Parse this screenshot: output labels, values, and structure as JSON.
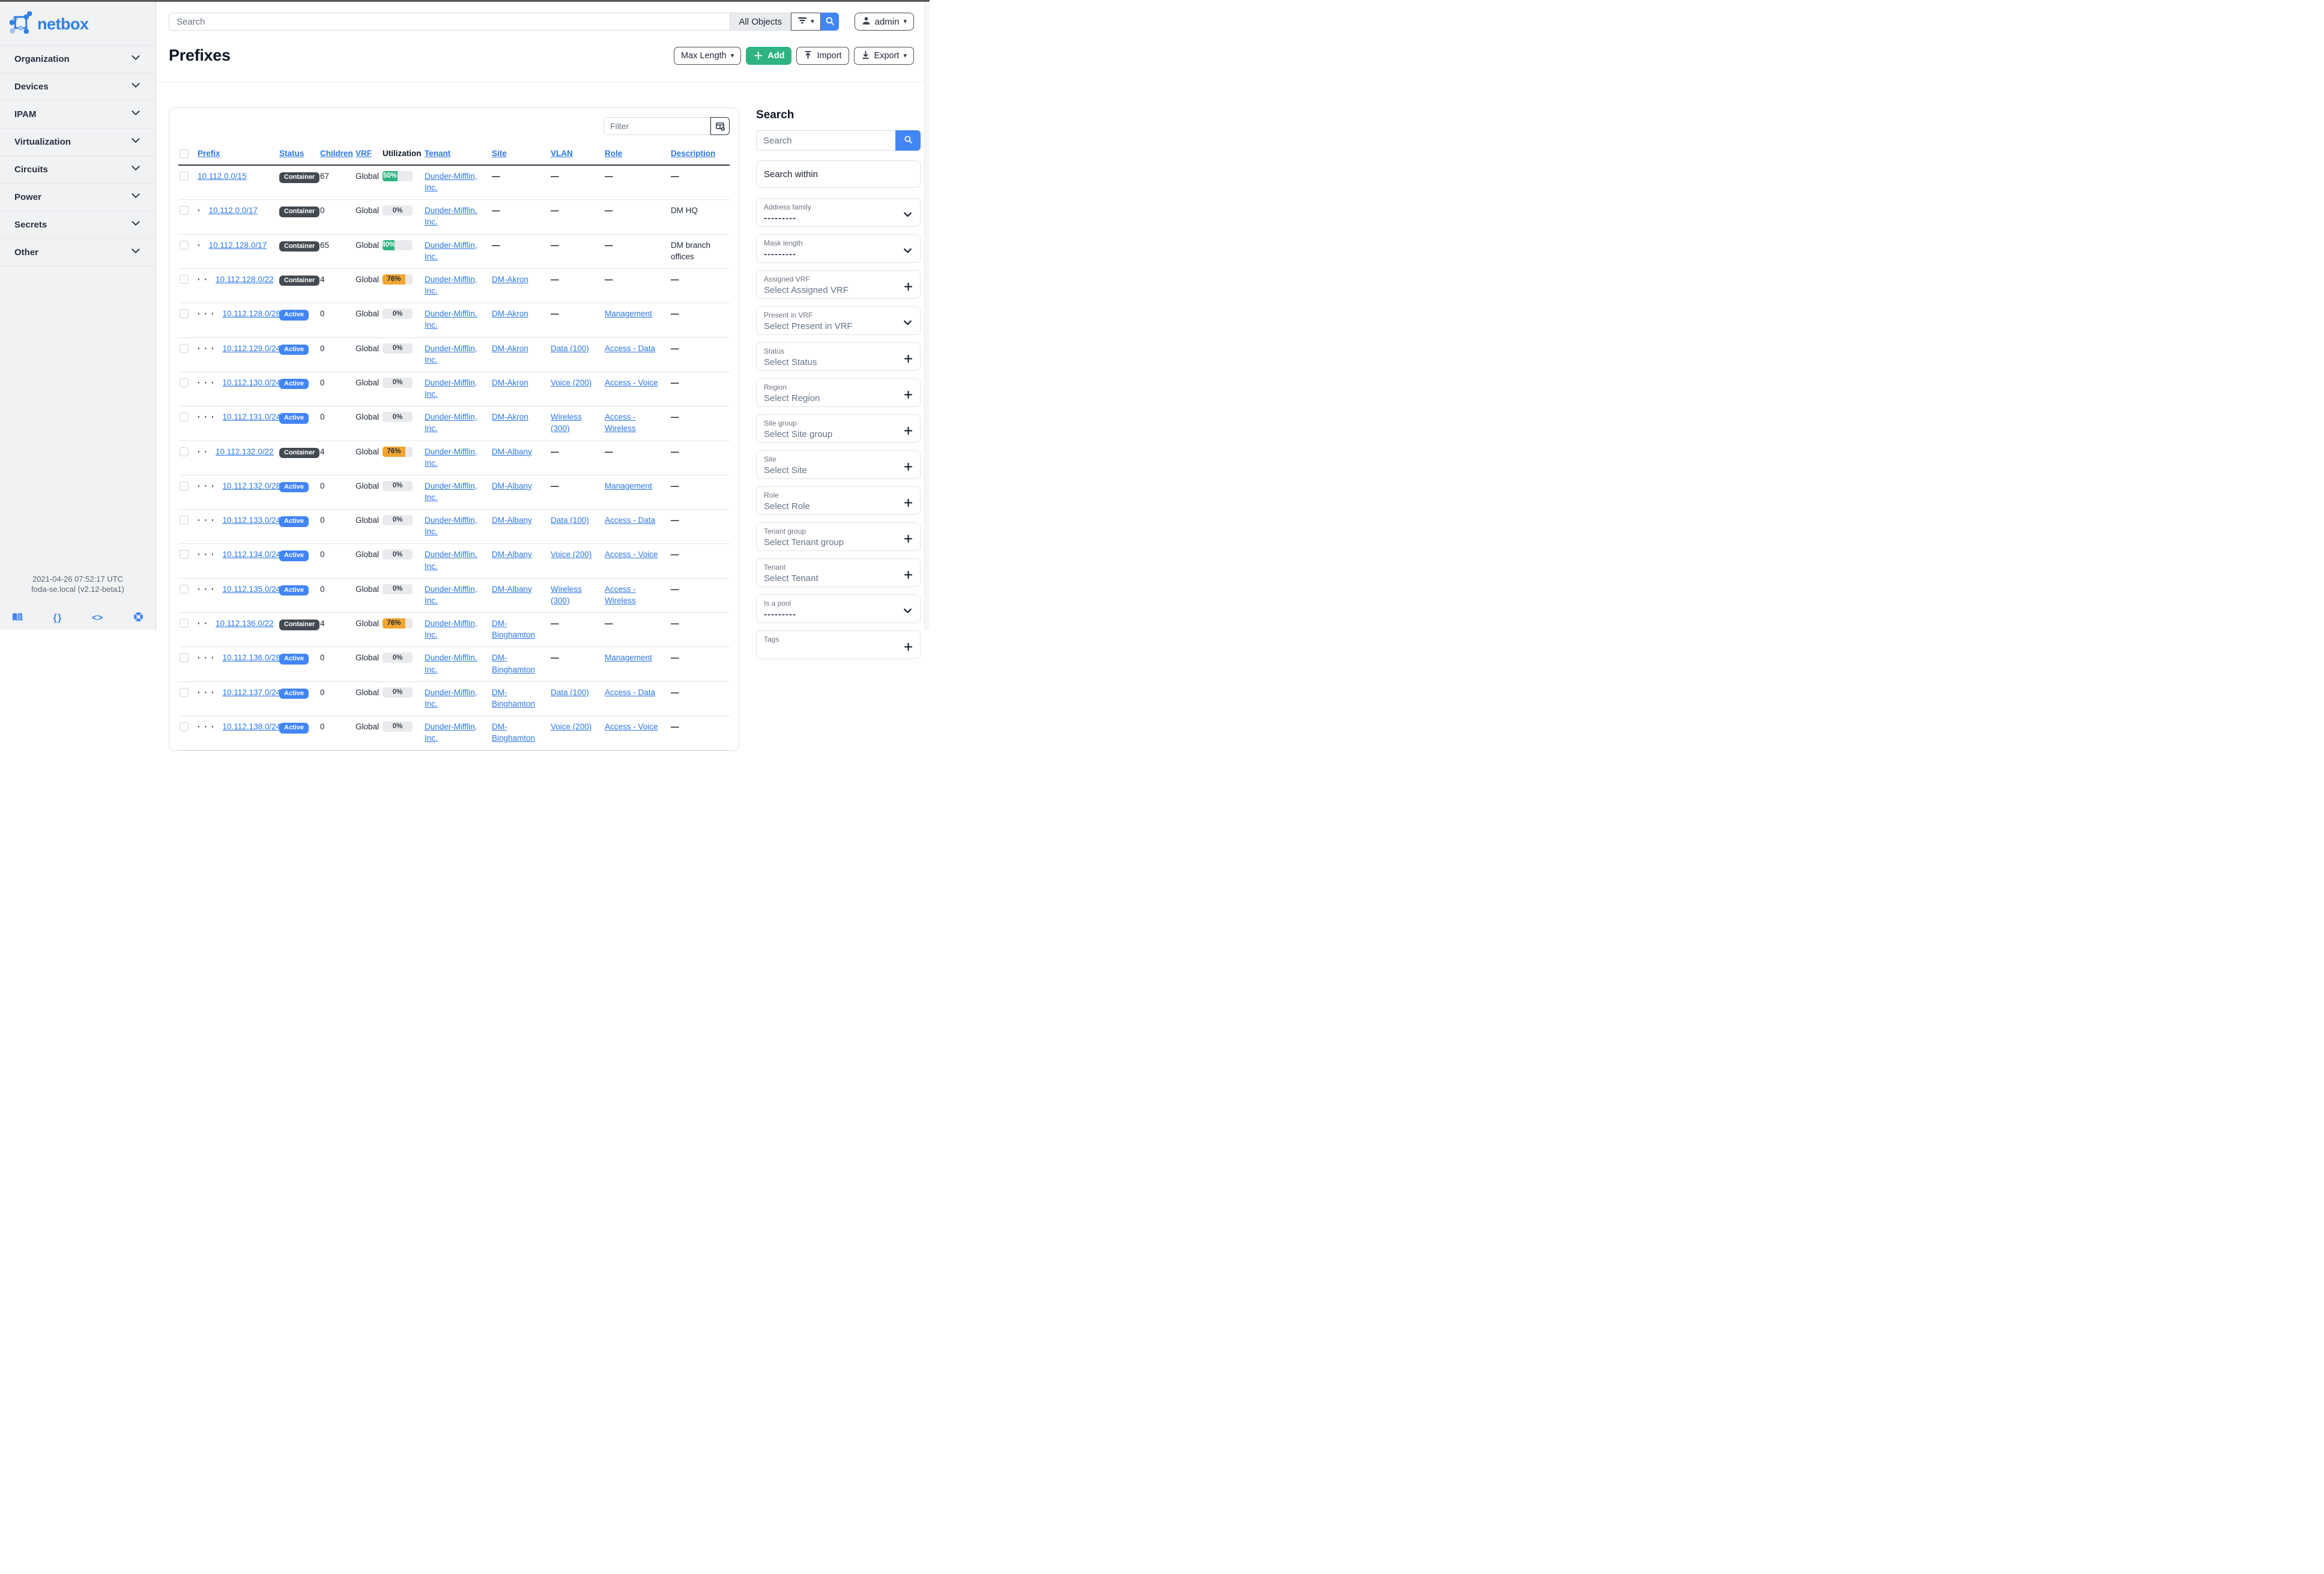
{
  "topbar": {
    "search_placeholder": "Search",
    "scope_label": "All Objects",
    "user_label": "admin"
  },
  "sidebar": {
    "brand": "netbox",
    "items": [
      {
        "label": "Organization"
      },
      {
        "label": "Devices"
      },
      {
        "label": "IPAM"
      },
      {
        "label": "Virtualization"
      },
      {
        "label": "Circuits"
      },
      {
        "label": "Power"
      },
      {
        "label": "Secrets"
      },
      {
        "label": "Other"
      }
    ],
    "footer": {
      "timestamp": "2021-04-26 07:52:17 UTC",
      "host": "foda-se.local (v2.12-beta1)",
      "icons": [
        "docs-book",
        "rest-api-braces",
        "code",
        "help-lifebuoy"
      ]
    }
  },
  "page": {
    "title": "Prefixes",
    "actions": {
      "max_length": "Max Length",
      "add": "Add",
      "import": "Import",
      "export": "Export"
    }
  },
  "table": {
    "filter_placeholder": "Filter",
    "columns": [
      {
        "label": "Prefix",
        "sortable": true
      },
      {
        "label": "Status",
        "sortable": true
      },
      {
        "label": "Children",
        "sortable": true
      },
      {
        "label": "VRF",
        "sortable": true
      },
      {
        "label": "Utilization",
        "sortable": false
      },
      {
        "label": "Tenant",
        "sortable": true
      },
      {
        "label": "Site",
        "sortable": true
      },
      {
        "label": "VLAN",
        "sortable": true
      },
      {
        "label": "Role",
        "sortable": true
      },
      {
        "label": "Description",
        "sortable": true
      }
    ],
    "rows": [
      {
        "depth": 0,
        "prefix": "10.112.0.0/15",
        "status": "Container",
        "children": "67",
        "vrf": "Global",
        "utilization": 50,
        "tenant": "Dunder-Mifflin, Inc.",
        "site": "—",
        "vlan": "—",
        "role": "—",
        "description": "—"
      },
      {
        "depth": 1,
        "prefix": "10.112.0.0/17",
        "status": "Container",
        "children": "0",
        "vrf": "Global",
        "utilization": 0,
        "tenant": "Dunder-Mifflin, Inc.",
        "site": "—",
        "vlan": "—",
        "role": "—",
        "description": "DM HQ"
      },
      {
        "depth": 1,
        "prefix": "10.112.128.0/17",
        "status": "Container",
        "children": "65",
        "vrf": "Global",
        "utilization": 40,
        "tenant": "Dunder-Mifflin, Inc.",
        "site": "—",
        "vlan": "—",
        "role": "—",
        "description": "DM branch offices"
      },
      {
        "depth": 2,
        "prefix": "10.112.128.0/22",
        "status": "Container",
        "children": "4",
        "vrf": "Global",
        "utilization": 76,
        "tenant": "Dunder-Mifflin, Inc.",
        "site": "DM-Akron",
        "vlan": "—",
        "role": "—",
        "description": "—"
      },
      {
        "depth": 3,
        "prefix": "10.112.128.0/28",
        "status": "Active",
        "children": "0",
        "vrf": "Global",
        "utilization": 0,
        "tenant": "Dunder-Mifflin, Inc.",
        "site": "DM-Akron",
        "vlan": "—",
        "role": "Management",
        "description": "—"
      },
      {
        "depth": 3,
        "prefix": "10.112.129.0/24",
        "status": "Active",
        "children": "0",
        "vrf": "Global",
        "utilization": 0,
        "tenant": "Dunder-Mifflin, Inc.",
        "site": "DM-Akron",
        "vlan": "Data (100)",
        "role": "Access - Data",
        "description": "—"
      },
      {
        "depth": 3,
        "prefix": "10.112.130.0/24",
        "status": "Active",
        "children": "0",
        "vrf": "Global",
        "utilization": 0,
        "tenant": "Dunder-Mifflin, Inc.",
        "site": "DM-Akron",
        "vlan": "Voice (200)",
        "role": "Access - Voice",
        "description": "—"
      },
      {
        "depth": 3,
        "prefix": "10.112.131.0/24",
        "status": "Active",
        "children": "0",
        "vrf": "Global",
        "utilization": 0,
        "tenant": "Dunder-Mifflin, Inc.",
        "site": "DM-Akron",
        "vlan": "Wireless (300)",
        "role": "Access - Wireless",
        "description": "—"
      },
      {
        "depth": 2,
        "prefix": "10.112.132.0/22",
        "status": "Container",
        "children": "4",
        "vrf": "Global",
        "utilization": 76,
        "tenant": "Dunder-Mifflin, Inc.",
        "site": "DM-Albany",
        "vlan": "—",
        "role": "—",
        "description": "—"
      },
      {
        "depth": 3,
        "prefix": "10.112.132.0/28",
        "status": "Active",
        "children": "0",
        "vrf": "Global",
        "utilization": 0,
        "tenant": "Dunder-Mifflin, Inc.",
        "site": "DM-Albany",
        "vlan": "—",
        "role": "Management",
        "description": "—"
      },
      {
        "depth": 3,
        "prefix": "10.112.133.0/24",
        "status": "Active",
        "children": "0",
        "vrf": "Global",
        "utilization": 0,
        "tenant": "Dunder-Mifflin, Inc.",
        "site": "DM-Albany",
        "vlan": "Data (100)",
        "role": "Access - Data",
        "description": "—"
      },
      {
        "depth": 3,
        "prefix": "10.112.134.0/24",
        "status": "Active",
        "children": "0",
        "vrf": "Global",
        "utilization": 0,
        "tenant": "Dunder-Mifflin, Inc.",
        "site": "DM-Albany",
        "vlan": "Voice (200)",
        "role": "Access - Voice",
        "description": "—"
      },
      {
        "depth": 3,
        "prefix": "10.112.135.0/24",
        "status": "Active",
        "children": "0",
        "vrf": "Global",
        "utilization": 0,
        "tenant": "Dunder-Mifflin, Inc.",
        "site": "DM-Albany",
        "vlan": "Wireless (300)",
        "role": "Access - Wireless",
        "description": "—"
      },
      {
        "depth": 2,
        "prefix": "10.112.136.0/22",
        "status": "Container",
        "children": "4",
        "vrf": "Global",
        "utilization": 76,
        "tenant": "Dunder-Mifflin, Inc.",
        "site": "DM-Binghamton",
        "vlan": "—",
        "role": "—",
        "description": "—"
      },
      {
        "depth": 3,
        "prefix": "10.112.136.0/28",
        "status": "Active",
        "children": "0",
        "vrf": "Global",
        "utilization": 0,
        "tenant": "Dunder-Mifflin, Inc.",
        "site": "DM-Binghamton",
        "vlan": "—",
        "role": "Management",
        "description": "—"
      },
      {
        "depth": 3,
        "prefix": "10.112.137.0/24",
        "status": "Active",
        "children": "0",
        "vrf": "Global",
        "utilization": 0,
        "tenant": "Dunder-Mifflin, Inc.",
        "site": "DM-Binghamton",
        "vlan": "Data (100)",
        "role": "Access - Data",
        "description": "—"
      },
      {
        "depth": 3,
        "prefix": "10.112.138.0/24",
        "status": "Active",
        "children": "0",
        "vrf": "Global",
        "utilization": 0,
        "tenant": "Dunder-Mifflin, Inc.",
        "site": "DM-Binghamton",
        "vlan": "Voice (200)",
        "role": "Access - Voice",
        "description": "—"
      }
    ]
  },
  "search_panel": {
    "title": "Search",
    "search_placeholder": "Search",
    "search_within_label": "Search within",
    "filters": [
      {
        "label": "Address family",
        "value": "---------",
        "control": "chevron"
      },
      {
        "label": "Mask length",
        "value": "---------",
        "control": "chevron"
      },
      {
        "label": "Assigned VRF",
        "value": "Select Assigned VRF",
        "control": "plus"
      },
      {
        "label": "Present in VRF",
        "value": "Select Present in VRF",
        "control": "chevron"
      },
      {
        "label": "Status",
        "value": "Select Status",
        "control": "plus"
      },
      {
        "label": "Region",
        "value": "Select Region",
        "control": "plus"
      },
      {
        "label": "Site group",
        "value": "Select Site group",
        "control": "plus"
      },
      {
        "label": "Site",
        "value": "Select Site",
        "control": "plus"
      },
      {
        "label": "Role",
        "value": "Select Role",
        "control": "plus"
      },
      {
        "label": "Tenant group",
        "value": "Select Tenant group",
        "control": "plus"
      },
      {
        "label": "Tenant",
        "value": "Select Tenant",
        "control": "plus"
      },
      {
        "label": "Is a pool",
        "value": "---------",
        "control": "chevron"
      },
      {
        "label": "Tags",
        "value": "",
        "control": "plus"
      }
    ]
  },
  "colors": {
    "accent_blue": "#4285f4",
    "link_blue": "#2b77e5",
    "badge_container": "#434a52",
    "badge_active": "#4285f4",
    "util_green": "#2fb380",
    "util_orange": "#f0a531",
    "add_green": "#2fb380"
  }
}
